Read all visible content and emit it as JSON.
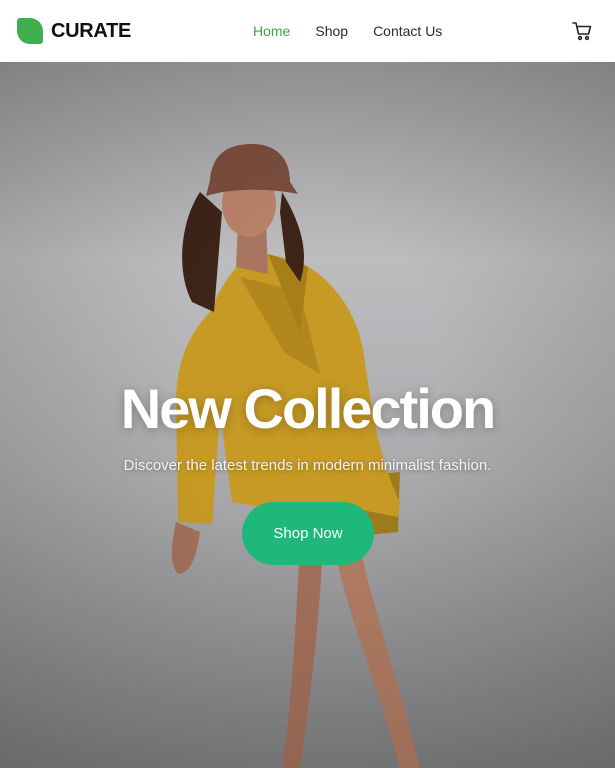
{
  "brand": {
    "name": "CURATE",
    "logo": "leaf-shape",
    "logo_color": "#3fb04c"
  },
  "nav": {
    "items": [
      {
        "label": "Home",
        "active": true
      },
      {
        "label": "Shop",
        "active": false
      },
      {
        "label": "Contact Us",
        "active": false
      }
    ],
    "active_color": "#3aa64a",
    "cart_icon": "cart-icon"
  },
  "hero": {
    "title": "New Collection",
    "subtitle": "Discover the latest trends in modern minimalist fashion.",
    "cta_label": "Shop Now",
    "cta_color": "#1db87a",
    "image": "model in mustard blazer and brown bucket hat"
  }
}
